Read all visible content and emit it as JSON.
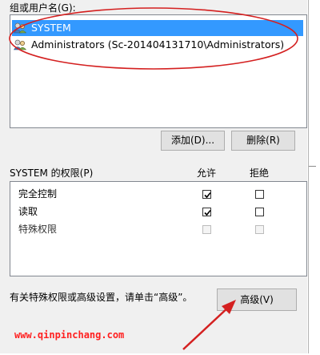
{
  "group_label": "组或用户名(G):",
  "users": [
    {
      "name": "SYSTEM",
      "icon": "user-group-icon",
      "selected": true
    },
    {
      "name": "Administrators (Sc-201404131710\\Administrators)",
      "icon": "user-group-icon",
      "selected": false
    }
  ],
  "buttons": {
    "add": "添加(D)...",
    "remove": "删除(R)",
    "advanced": "高级(V)"
  },
  "permissions": {
    "label": "SYSTEM 的权限(P)",
    "allow_header": "允许",
    "deny_header": "拒绝",
    "rows": [
      {
        "name": "完全控制",
        "allow": "checked",
        "deny": "unchecked"
      },
      {
        "name": "读取",
        "allow": "checked",
        "deny": "unchecked"
      },
      {
        "name": "特殊权限",
        "allow": "disabled",
        "deny": "disabled"
      }
    ]
  },
  "advanced_hint": "有关特殊权限或高级设置，请单击“高级”。",
  "watermark": "www.qinpinchang.com",
  "colors": {
    "selection": "#3399ff",
    "annotation": "#d42020",
    "watermark": "#ff2020"
  }
}
